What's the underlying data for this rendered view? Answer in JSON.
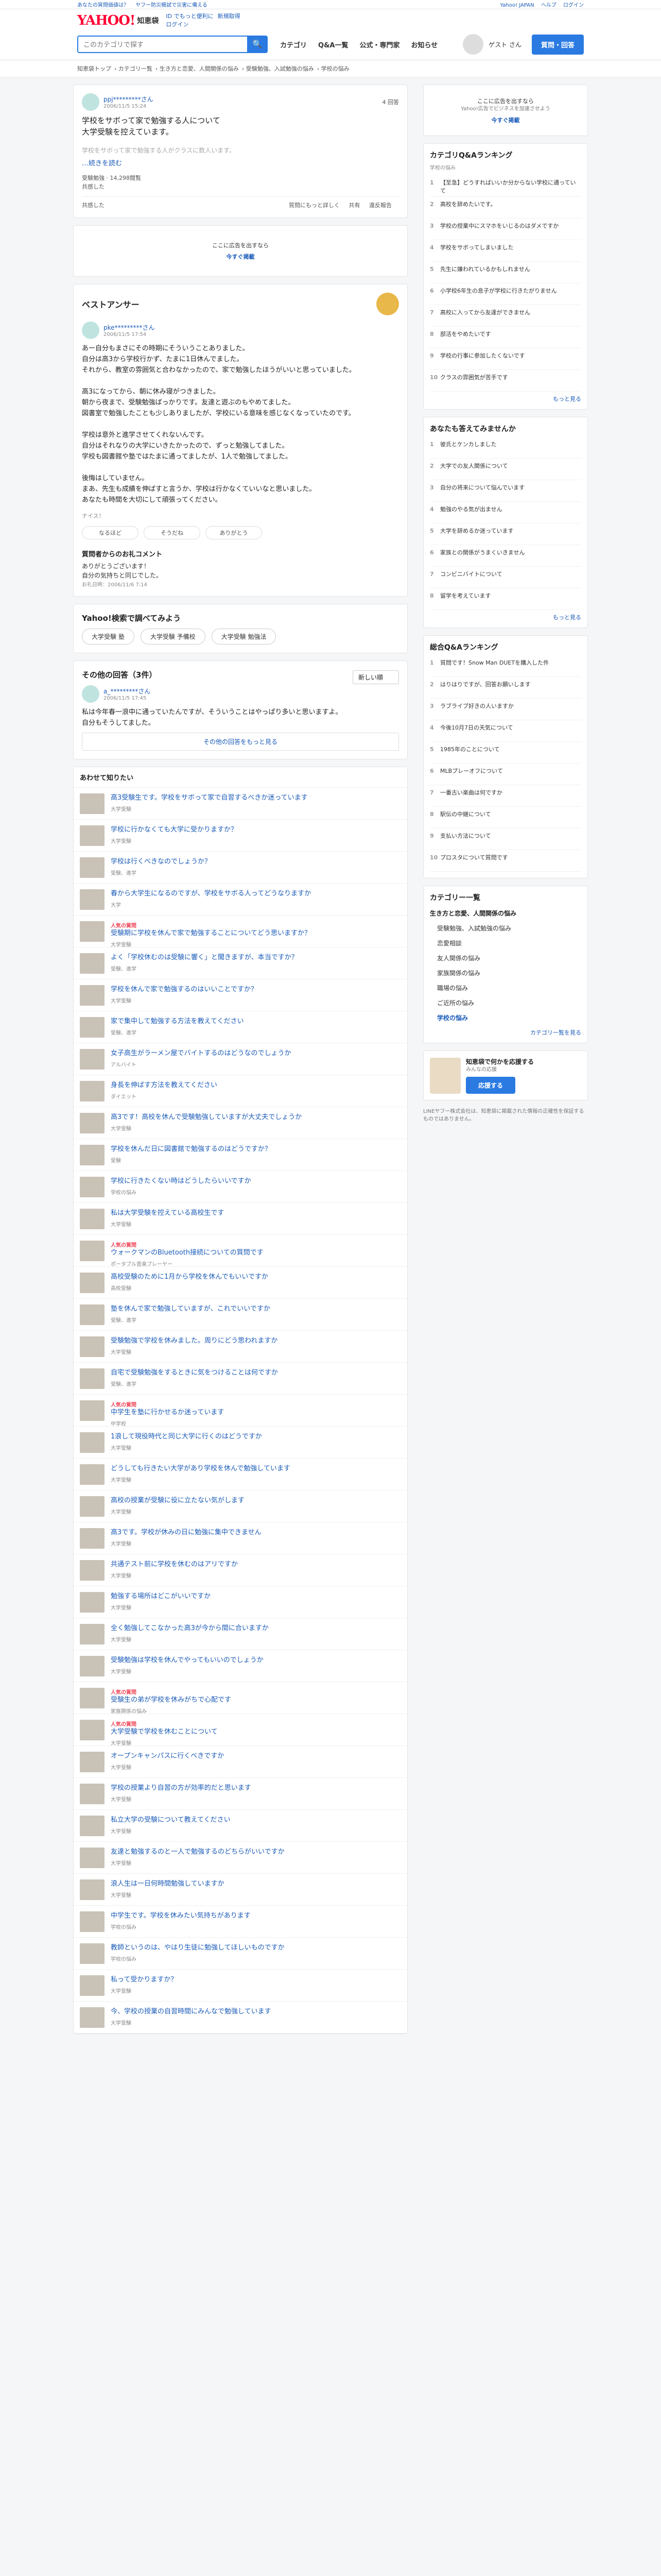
{
  "topbar": {
    "links": [
      "あなたの質問価値は？",
      "ヤフー防災模試で災害に備える"
    ],
    "right": [
      "Yahoo! JAPAN",
      "ヘルプ",
      "ログイン"
    ]
  },
  "header": {
    "logo": "YAHOO!",
    "logo_sub": "知恵袋",
    "links_row1": [
      "ID でもっと便利に",
      "新規取得"
    ],
    "links_row2": [
      "ログイン"
    ]
  },
  "search": {
    "placeholder": "このカテゴリで探す",
    "button": "🔍"
  },
  "nav": [
    "カテゴリ",
    "Q&A一覧",
    "公式・専門家",
    "お知らせ"
  ],
  "login_button": "質問・回答",
  "user_label": "ゲスト さん",
  "breadcrumb": [
    "知恵袋トップ",
    "カテゴリ一覧",
    "生き方と恋愛、人間関係の悩み",
    "受験勉強、入試勉強の悩み",
    "学校の悩み"
  ],
  "question": {
    "user": "ppj*********さん",
    "date": "2006/11/5 15:24",
    "answers_count": "4 回答",
    "body": "学校をサボって家で勉強する人について\n大学受験を控えています。",
    "blur_text": "学校をサボって家で勉強する人がクラスに数人います。",
    "more": "…続きを読む",
    "meta1": "受験勉強 · 14,298閲覧",
    "meta2": "共感した",
    "actions_left": [
      "共感した"
    ],
    "actions_right": [
      "質問にもっと詳しく",
      "共有",
      "違反報告"
    ]
  },
  "ad": {
    "text": "ここに広告を出すなら",
    "cta": "今すぐ掲載"
  },
  "best_answer": {
    "title": "ベストアンサー",
    "user": "pke*********さん",
    "date": "2006/11/5 17:54",
    "text": "あー自分もまさにその時期にそういうことありました。\n自分は高3から学校行かず、たまに1日休んでました。\nそれから、教室の雰囲気と合わなかったので、家で勉強したほうがいいと思っていました。\n\n高3になってから、朝に休み寝がつきました。\n朝から夜まで、受験勉強ばっかりです。友達と遊ぶのもやめてました。\n図書室で勉強したことも少しありましたが、学校にいる意味を感じなくなっていたのです。\n\n学校は意外と進学させてくれないんです。\n自分はそれなりの大学にいきたかったので、ずっと勉強してました。\n学校も図書館や塾ではたまに通ってましたが、1人で勉強してました。\n\n後悔はしていません。\nまあ、先生も成績を伸ばすと言うか、学校は行かなくていいなと思いました。\nあなたも時間を大切にして頑張ってください。",
    "note": "ナイス！",
    "reactions": [
      "なるほど",
      "そうだね",
      "ありがとう"
    ]
  },
  "comment": {
    "title": "質問者からのお礼コメント",
    "text": "ありがとうございます！\n自分の気持ちと同じでした。",
    "date": "お礼日時：2006/11/6 7:14"
  },
  "search_more": {
    "title": "Yahoo!検索で調べてみよう",
    "chips": [
      "大学受験 塾",
      "大学受験 予備校",
      "大学受験 勉強法"
    ]
  },
  "other": {
    "title": "その他の回答（3件）",
    "sort": "新しい順",
    "user": "a_*********さん",
    "date": "2006/11/5 17:45",
    "text": "私は今年春一浪中に通っていたんですが、そういうことはやっぱり多いと思いますよ。\n自分もそうしてました。",
    "more": "その他の回答をもっと見る"
  },
  "recs": {
    "title": "あわせて知りたい",
    "items": [
      {
        "title": "高3受験生です。学校をサボって家で自習するべきか迷っています",
        "tag": "大学受験",
        "hot": ""
      },
      {
        "title": "学校に行かなくても大学に受かりますか？",
        "tag": "大学受験",
        "hot": ""
      },
      {
        "title": "学校は行くべきなのでしょうか？",
        "tag": "受験、進学",
        "hot": ""
      },
      {
        "title": "春から大学生になるのですが、学校をサボる人ってどうなりますか",
        "tag": "大学",
        "hot": ""
      },
      {
        "title": "受験期に学校を休んで家で勉強することについてどう思いますか？",
        "tag": "大学受験",
        "hot": "人気の質問"
      },
      {
        "title": "よく「学校休むのは受験に響く」と聞きますが、本当ですか？",
        "tag": "受験、進学",
        "hot": ""
      },
      {
        "title": "学校を休んで家で勉強するのはいいことですか？",
        "tag": "大学受験",
        "hot": ""
      },
      {
        "title": "家で集中して勉強する方法を教えてください",
        "tag": "受験、進学",
        "hot": ""
      },
      {
        "title": "女子高生がラーメン屋でバイトするのはどうなのでしょうか",
        "tag": "アルバイト",
        "hot": ""
      },
      {
        "title": "身長を伸ばす方法を教えてください",
        "tag": "ダイエット",
        "hot": ""
      },
      {
        "title": "高3です！高校を休んで受験勉強していますが大丈夫でしょうか",
        "tag": "大学受験",
        "hot": ""
      },
      {
        "title": "学校を休んだ日に図書館で勉強するのはどうですか？",
        "tag": "受験",
        "hot": ""
      },
      {
        "title": "学校に行きたくない時はどうしたらいいですか",
        "tag": "学校の悩み",
        "hot": ""
      },
      {
        "title": "私は大学受験を控えている高校生です",
        "tag": "大学受験",
        "hot": ""
      },
      {
        "title": "ウォークマンのBluetooth接続についての質問です",
        "tag": "ポータブル音楽プレーヤー",
        "hot": "人気の質問"
      },
      {
        "title": "高校受験のために1月から学校を休んでもいいですか",
        "tag": "高校受験",
        "hot": ""
      },
      {
        "title": "塾を休んで家で勉強していますが、これでいいですか",
        "tag": "受験、進学",
        "hot": ""
      },
      {
        "title": "受験勉強で学校を休みました。周りにどう思われますか",
        "tag": "大学受験",
        "hot": ""
      },
      {
        "title": "自宅で受験勉強をするときに気をつけることは何ですか",
        "tag": "受験、進学",
        "hot": ""
      },
      {
        "title": "中学生を塾に行かせるか迷っています",
        "tag": "中学校",
        "hot": "人気の質問"
      },
      {
        "title": "1浪して現役時代と同じ大学に行くのはどうですか",
        "tag": "大学受験",
        "hot": ""
      },
      {
        "title": "どうしても行きたい大学があり学校を休んで勉強しています",
        "tag": "大学受験",
        "hot": ""
      },
      {
        "title": "高校の授業が受験に役に立たない気がします",
        "tag": "大学受験",
        "hot": ""
      },
      {
        "title": "高3です。学校が休みの日に勉強に集中できません",
        "tag": "大学受験",
        "hot": ""
      },
      {
        "title": "共通テスト前に学校を休むのはアリですか",
        "tag": "大学受験",
        "hot": ""
      },
      {
        "title": "勉強する場所はどこがいいですか",
        "tag": "大学受験",
        "hot": ""
      },
      {
        "title": "全く勉強してこなかった高3が今から間に合いますか",
        "tag": "大学受験",
        "hot": ""
      },
      {
        "title": "受験勉強は学校を休んでやってもいいのでしょうか",
        "tag": "大学受験",
        "hot": ""
      },
      {
        "title": "受験生の弟が学校を休みがちで心配です",
        "tag": "家族関係の悩み",
        "hot": "人気の質問"
      },
      {
        "title": "大学受験で学校を休むことについて",
        "tag": "大学受験",
        "hot": "人気の質問"
      },
      {
        "title": "オープンキャンパスに行くべきですか",
        "tag": "大学受験",
        "hot": ""
      },
      {
        "title": "学校の授業より自習の方が効率的だと思います",
        "tag": "大学受験",
        "hot": ""
      },
      {
        "title": "私立大学の受験について教えてください",
        "tag": "大学受験",
        "hot": ""
      },
      {
        "title": "友達と勉強するのと一人で勉強するのどちらがいいですか",
        "tag": "大学受験",
        "hot": ""
      },
      {
        "title": "浪人生は一日何時間勉強していますか",
        "tag": "大学受験",
        "hot": ""
      },
      {
        "title": "中学生です。学校を休みたい気持ちがあります",
        "tag": "学校の悩み",
        "hot": ""
      },
      {
        "title": "教師というのは、やはり生徒に勉強してほしいものですか",
        "tag": "学校の悩み",
        "hot": ""
      },
      {
        "title": "私って受かりますか？",
        "tag": "大学受験",
        "hot": ""
      },
      {
        "title": "今、学校の授業の自習時間にみんなで勉強しています",
        "tag": "大学受験",
        "hot": ""
      }
    ]
  },
  "side_ad": {
    "text": "ここに広告を出すなら",
    "sub": "Yahoo!広告でビジネスを加速させよう",
    "cta": "今すぐ掲載"
  },
  "ranking1": {
    "title": "カテゴリQ&Aランキング",
    "sub": "学校の悩み",
    "items": [
      "【至急】どうすればいいか分からない学校に通っていて",
      "高校を辞めたいです。",
      "学校の授業中にスマホをいじるのはダメですか",
      "学校をサボってしまいました",
      "先生に嫌われているかもしれません",
      "小学校6年生の息子が学校に行きたがりません",
      "高校に入ってから友達ができません",
      "部活をやめたいです",
      "学校の行事に参加したくないです",
      "クラスの雰囲気が苦手です"
    ],
    "more": "もっと見る"
  },
  "ranking2": {
    "title": "あなたも答えてみませんか",
    "items": [
      "彼氏とケンカしました",
      "大学での友人関係について",
      "自分の将来について悩んでいます",
      "勉強のやる気が出ません",
      "大学を辞めるか迷っています",
      "家族との関係がうまくいきません",
      "コンビニバイトについて",
      "留学を考えています"
    ],
    "more": "もっと見る"
  },
  "ranking3": {
    "title": "総合Q&Aランキング",
    "items": [
      "質問です！Snow Man DUETを購入した件",
      "はりはりですが、回答お願いします",
      "ラブライブ好きの人いますか",
      "今後10月7日の天気について",
      "1985年のことについて",
      "MLBプレーオフについて",
      "一番古い楽曲は何ですか",
      "駅伝の中継について",
      "支払い方法について",
      "プロスタについて質問です"
    ]
  },
  "categories": {
    "title": "カテゴリー一覧",
    "parent": "生き方と恋愛、人間関係の悩み",
    "items": [
      "受験勉強、入試勉強の悩み",
      "恋愛相談",
      "友人関係の悩み",
      "家族関係の悩み",
      "職場の悩み",
      "ご近所の悩み",
      "学校の悩み"
    ],
    "current_index": 6,
    "more": "カテゴリ一覧を見る"
  },
  "cheer": {
    "title": "知恵袋で何かを応援する",
    "sub": "みんなの応援",
    "cta": "応援する"
  },
  "side_notes": "LINEヤフー株式会社は、知恵袋に掲載された情報の正確性を保証するものではありません。"
}
